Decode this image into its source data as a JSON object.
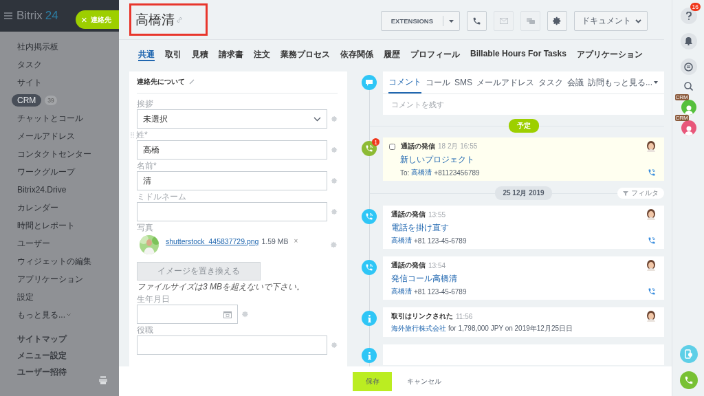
{
  "sidebar": {
    "logo": {
      "name": "Bitrix",
      "number": "24"
    },
    "contact_button": {
      "close": "×",
      "label": "連絡先"
    },
    "items": [
      {
        "label": "社内掲示板",
        "selected": false
      },
      {
        "label": "タスク",
        "selected": false
      },
      {
        "label": "サイト",
        "selected": false
      },
      {
        "label": "CRM",
        "selected": true,
        "counter": "39"
      },
      {
        "label": "チャットとコール",
        "selected": false
      },
      {
        "label": "メールアドレス",
        "selected": false
      },
      {
        "label": "コンタクトセンター",
        "selected": false
      },
      {
        "label": "ワークグループ",
        "selected": false
      },
      {
        "label": "Bitrix24.Drive",
        "selected": false
      },
      {
        "label": "カレンダー",
        "selected": false
      },
      {
        "label": "時間とレポート",
        "selected": false
      },
      {
        "label": "ユーザー",
        "selected": false
      },
      {
        "label": "ウィジェットの編集",
        "selected": false
      },
      {
        "label": "アプリケーション",
        "selected": false
      },
      {
        "label": "設定",
        "selected": false
      },
      {
        "label": "もっと見る...",
        "selected": false,
        "caret": true
      }
    ],
    "footer_links": [
      "サイトマップ",
      "メニュー設定",
      "ユーザー招待"
    ]
  },
  "header": {
    "title": "高橋清",
    "extensions": "EXTENSIONS",
    "icon_buttons": [
      {
        "kind": "phone",
        "disabled": false
      },
      {
        "kind": "mail",
        "disabled": true
      },
      {
        "kind": "chat",
        "disabled": true
      },
      {
        "kind": "settings",
        "disabled": false
      }
    ],
    "documents": "ドキュメント"
  },
  "tabs": [
    {
      "label": "共通",
      "selected": true
    },
    {
      "label": "取引",
      "selected": false
    },
    {
      "label": "見積",
      "selected": false
    },
    {
      "label": "請求書",
      "selected": false
    },
    {
      "label": "注文",
      "selected": false
    },
    {
      "label": "業務プロセス",
      "selected": false
    },
    {
      "label": "依存関係",
      "selected": false
    },
    {
      "label": "履歴",
      "selected": false
    },
    {
      "label": "プロフィール",
      "selected": false
    },
    {
      "label": "Billable Hours For Tasks",
      "selected": false
    },
    {
      "label": "アプリケーション",
      "selected": false
    }
  ],
  "form": {
    "title": "連絡先について",
    "fields": [
      {
        "kind": "select",
        "label": "挨拶",
        "value": "未選択"
      },
      {
        "kind": "text",
        "label": "姓*",
        "value": "高橋",
        "handle": true
      },
      {
        "kind": "text",
        "label": "名前*",
        "value": "清"
      },
      {
        "kind": "text",
        "label": "ミドルネーム"
      },
      {
        "label": "写真",
        "file": "shutterstock_445837729.png",
        "size": "1.59 MB",
        "remove": "×",
        "button": "イメージを置き換える",
        "note": "ファイルサイズは3 MBを超えないで下さい。"
      },
      {
        "kind": "date",
        "label": "生年月日"
      },
      {
        "kind": "text",
        "label": "役職"
      }
    ]
  },
  "timeline": {
    "composer": {
      "tabs": [
        {
          "label": "コメント",
          "selected": true
        },
        {
          "label": "コール",
          "selected": false
        },
        {
          "label": "SMS",
          "selected": false
        },
        {
          "label": "メールアドレス",
          "selected": false
        },
        {
          "label": "タスク",
          "selected": false
        },
        {
          "label": "会議",
          "selected": false
        },
        {
          "label": "訪問もっと見る...",
          "selected": false,
          "caret": true
        }
      ],
      "placeholder": "コメントを残す"
    },
    "planned_label": "予定",
    "scheduled": [
      {
        "kind": "call",
        "badge": "1",
        "checkbox": {
          "checked": false
        },
        "title": "通話の発信",
        "time": "18 2月 16:55",
        "link": "新しいプロジェクト",
        "prefix": "To:",
        "contact": "高橋清",
        "phone": "+81123456789"
      }
    ],
    "date": "25 12月 2019",
    "filter": "フィルタ",
    "history": [
      {
        "kind": "call",
        "title": "通話の発信",
        "time": "13:55",
        "link": "電話を掛け直す",
        "contact": "高橋清",
        "phone": "+81 123-45-6789"
      },
      {
        "kind": "call",
        "title": "通話の発信",
        "time": "13:54",
        "link": "発信コール高橋清",
        "contact": "高橋清",
        "phone": "+81 123-45-6789"
      },
      {
        "kind": "info",
        "title": "取引はリンクされた",
        "time": "11:56",
        "company": "海外旅行株式会社",
        "detail": "for 1,798,000 JPY on 2019年12月25日日"
      },
      {
        "kind": "info"
      }
    ]
  },
  "footer": {
    "save": "保存",
    "cancel": "キャンセル"
  },
  "right_bar": {
    "help_badge": "16",
    "avatars": [
      {
        "color": "#55c03c",
        "label": "CRM"
      },
      {
        "color": "#e8577a",
        "label": "CRM"
      }
    ]
  }
}
